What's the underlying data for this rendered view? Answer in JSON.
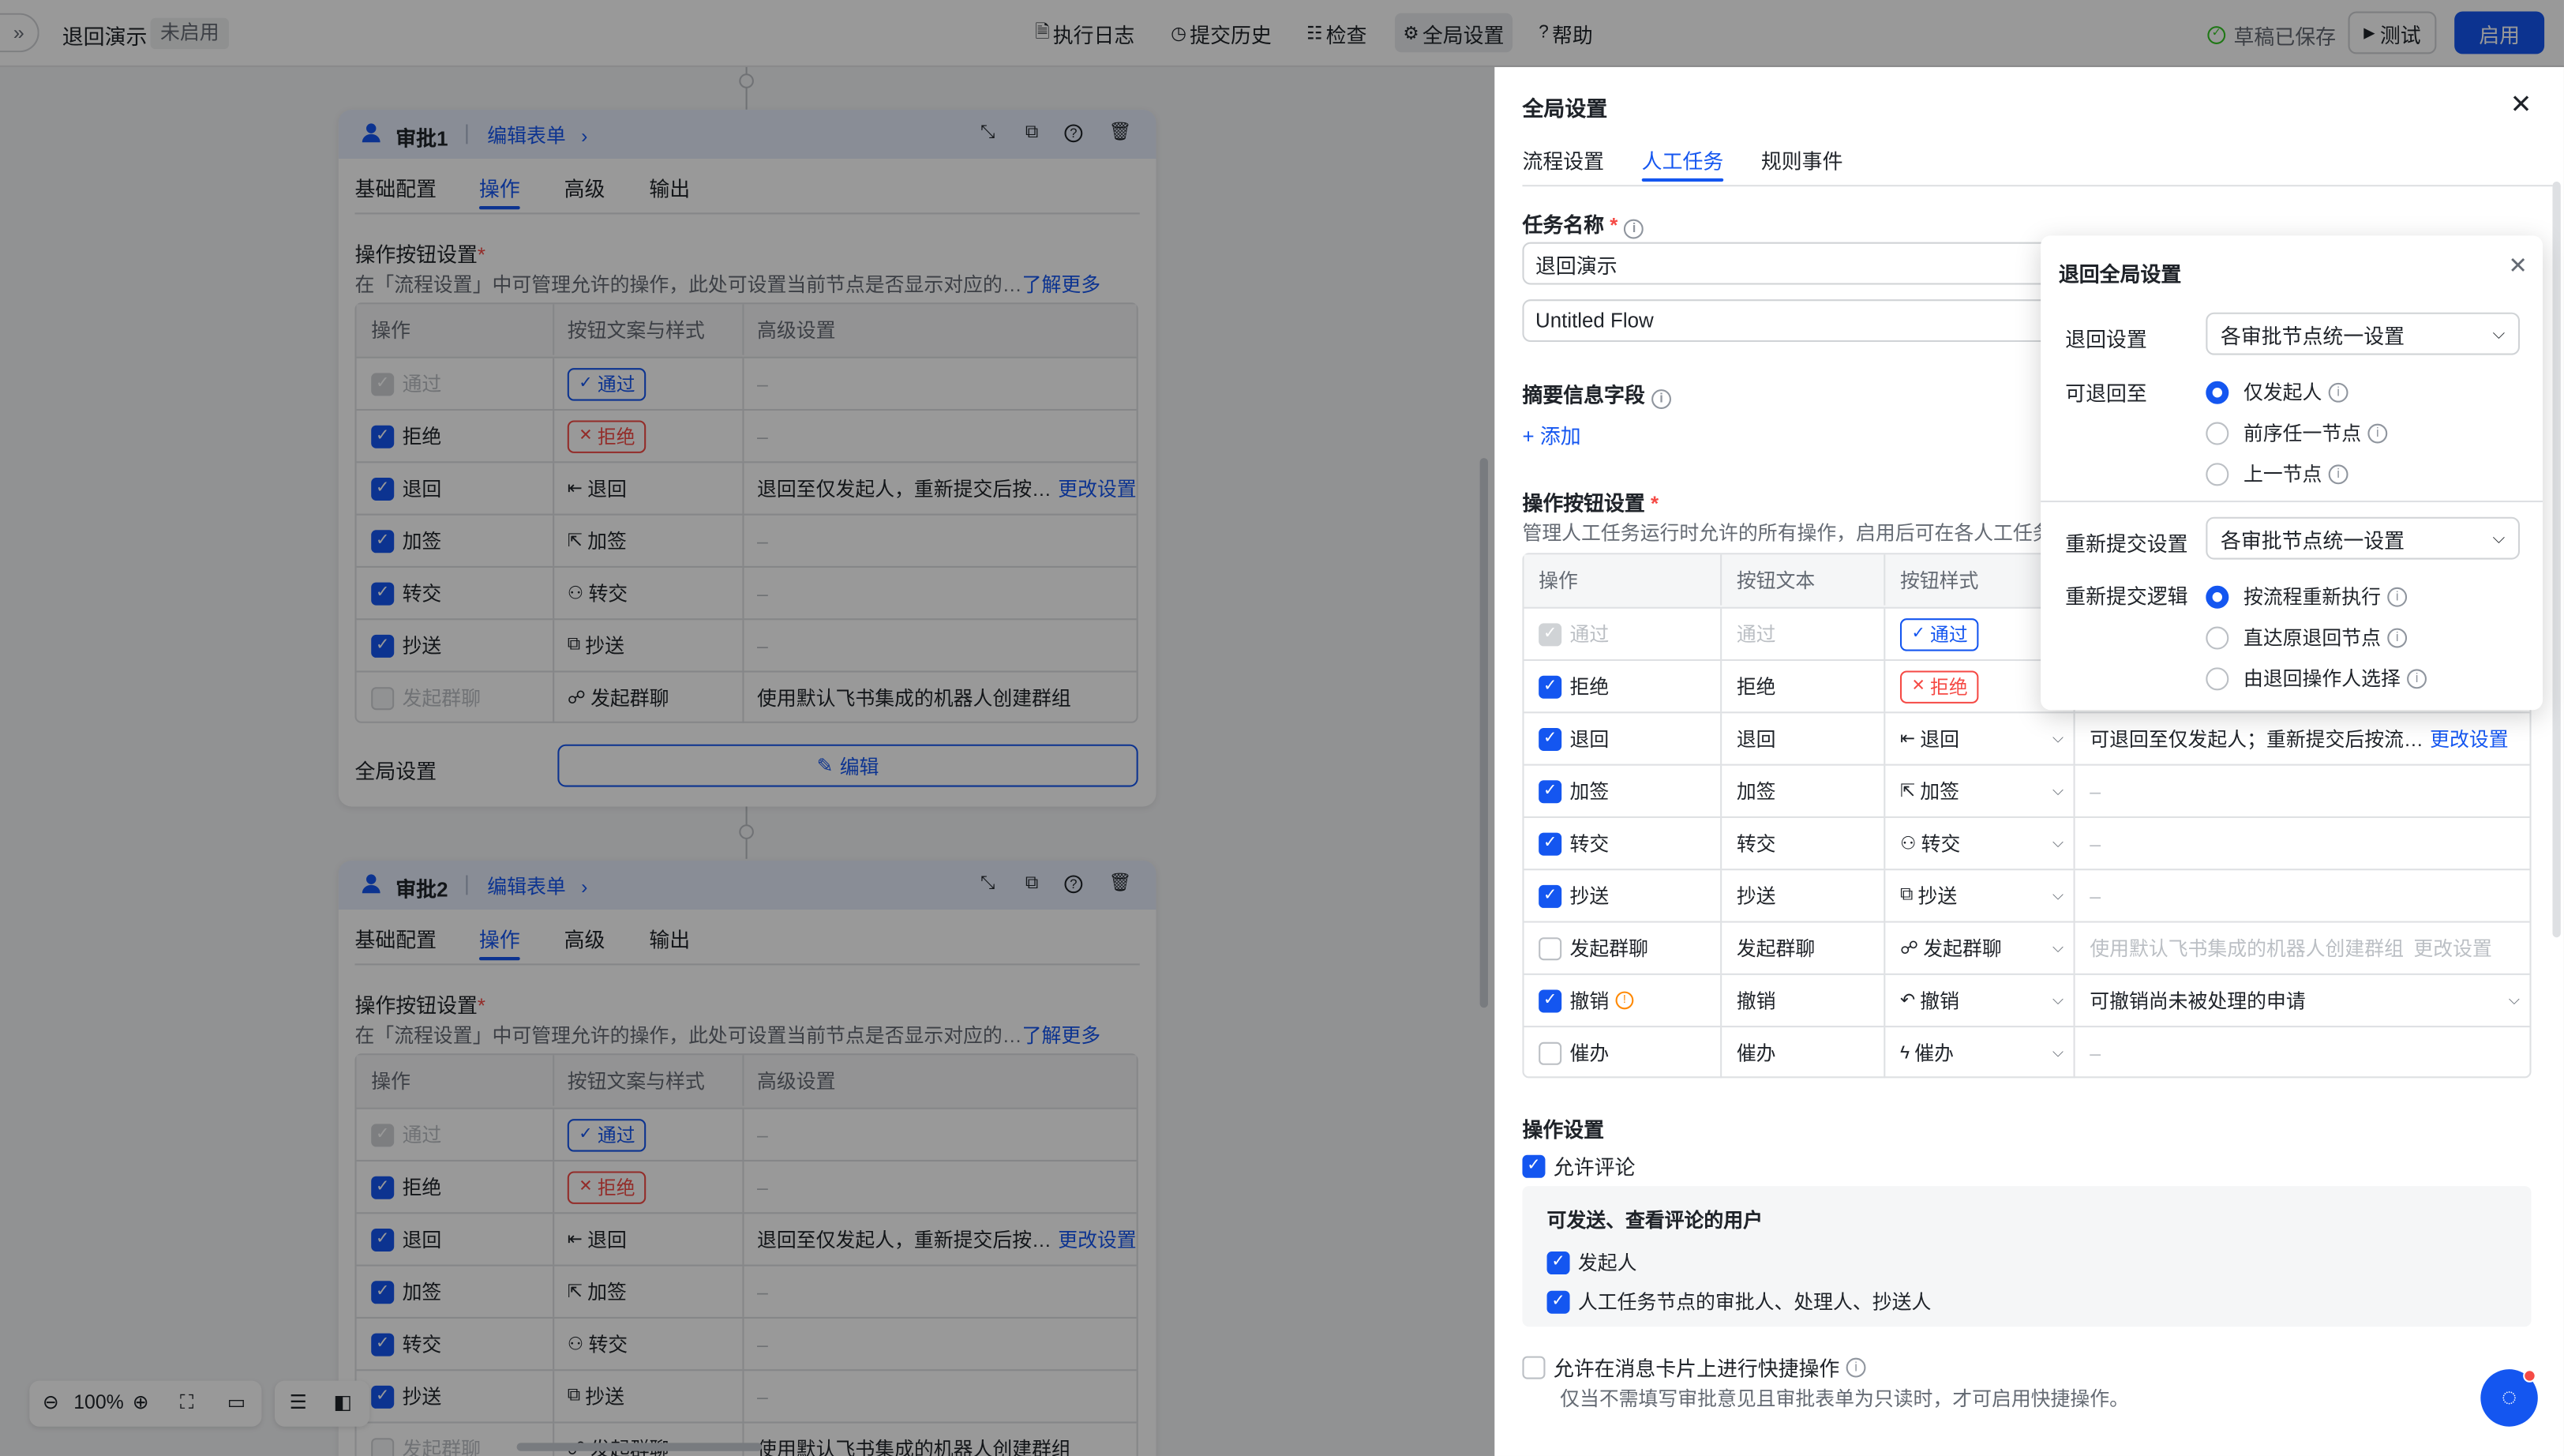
{
  "topbar": {
    "title": "退回演示",
    "status": "未启用",
    "nav": [
      {
        "icon": "log-icon",
        "glyph": "🗎",
        "label": "执行日志"
      },
      {
        "icon": "history-icon",
        "glyph": "◷",
        "label": "提交历史"
      },
      {
        "icon": "check-icon",
        "glyph": "☷",
        "label": "检查"
      },
      {
        "icon": "gear-icon",
        "glyph": "⚙",
        "label": "全局设置"
      },
      {
        "icon": "help-icon",
        "glyph": "?",
        "label": "帮助"
      }
    ],
    "saved": "草稿已保存",
    "test": "测试",
    "enable": "启用"
  },
  "canvas": {
    "nodes": [
      {
        "title": "审批1",
        "edit_form": "编辑表单",
        "tabs": [
          "基础配置",
          "操作",
          "高级",
          "输出"
        ],
        "section": "操作按钮设置",
        "desc": "在「流程设置」中可管理允许的操作，此处可设置当前节点是否显示对应的…",
        "more": "了解更多",
        "headers": [
          "操作",
          "按钮文案与样式",
          "高级设置"
        ],
        "rows": [
          {
            "op": "通过",
            "state": "checked-disabled",
            "btn": "通过",
            "style": "blue-pill",
            "glyph": "✓",
            "adv": "–"
          },
          {
            "op": "拒绝",
            "state": "checked",
            "btn": "拒绝",
            "style": "red-pill",
            "glyph": "✕",
            "adv": "–"
          },
          {
            "op": "退回",
            "state": "checked",
            "btn": "退回",
            "style": "icon",
            "glyph": "⇤",
            "adv": "退回至仅发起人，重新提交后按…",
            "adv_link": "更改设置"
          },
          {
            "op": "加签",
            "state": "checked",
            "btn": "加签",
            "style": "icon",
            "glyph": "⇱",
            "adv": "–"
          },
          {
            "op": "转交",
            "state": "checked",
            "btn": "转交",
            "style": "icon",
            "glyph": "⚇",
            "adv": "–"
          },
          {
            "op": "抄送",
            "state": "checked",
            "btn": "抄送",
            "style": "icon",
            "glyph": "⧉",
            "adv": "–"
          },
          {
            "op": "发起群聊",
            "state": "unchecked-disabled",
            "btn": "发起群聊",
            "style": "icon",
            "glyph": "☍",
            "adv": "使用默认飞书集成的机器人创建群组"
          }
        ],
        "global_label": "全局设置",
        "global_btn": "编辑"
      },
      {
        "title": "审批2",
        "edit_form": "编辑表单",
        "tabs": [
          "基础配置",
          "操作",
          "高级",
          "输出"
        ],
        "section": "操作按钮设置",
        "desc": "在「流程设置」中可管理允许的操作，此处可设置当前节点是否显示对应的…",
        "more": "了解更多",
        "headers": [
          "操作",
          "按钮文案与样式",
          "高级设置"
        ],
        "rows": [
          {
            "op": "通过",
            "state": "checked-disabled",
            "btn": "通过",
            "style": "blue-pill",
            "glyph": "✓",
            "adv": "–"
          },
          {
            "op": "拒绝",
            "state": "checked",
            "btn": "拒绝",
            "style": "red-pill",
            "glyph": "✕",
            "adv": "–"
          },
          {
            "op": "退回",
            "state": "checked",
            "btn": "退回",
            "style": "icon",
            "glyph": "⇤",
            "adv": "退回至仅发起人，重新提交后按…",
            "adv_link": "更改设置"
          },
          {
            "op": "加签",
            "state": "checked",
            "btn": "加签",
            "style": "icon",
            "glyph": "⇱",
            "adv": "–"
          },
          {
            "op": "转交",
            "state": "checked",
            "btn": "转交",
            "style": "icon",
            "glyph": "⚇",
            "adv": "–"
          },
          {
            "op": "抄送",
            "state": "checked",
            "btn": "抄送",
            "style": "icon",
            "glyph": "⧉",
            "adv": "–"
          },
          {
            "op": "发起群聊",
            "state": "unchecked-disabled",
            "btn": "发起群聊",
            "style": "icon",
            "glyph": "☍",
            "adv": "使用默认飞书集成的机器人创建群组"
          }
        ]
      }
    ],
    "zoom": "100%"
  },
  "panel": {
    "title": "全局设置",
    "tabs": [
      "流程设置",
      "人工任务",
      "规则事件"
    ],
    "active_tab": 1,
    "task_name_label": "任务名称",
    "task_name_value": "退回演示",
    "flow_name_value": "Untitled Flow",
    "summary_label": "摘要信息字段",
    "add": "添加",
    "ops_label": "操作按钮设置",
    "ops_desc": "管理人工任务运行时允许的所有操作，启用后可在各人工任务",
    "headers": [
      "操作",
      "按钮文本",
      "按钮样式"
    ],
    "rows": [
      {
        "op": "通过",
        "state": "checked-disabled",
        "text": "通过",
        "style": "blue-pill",
        "glyph": "✓",
        "adv": ""
      },
      {
        "op": "拒绝",
        "state": "checked",
        "text": "拒绝",
        "style": "red-pill",
        "glyph": "✕",
        "adv": ""
      },
      {
        "op": "退回",
        "state": "checked",
        "text": "退回",
        "style": "icon",
        "glyph": "⇤",
        "adv": "可退回至仅发起人；重新提交后按流…",
        "adv_link": "更改设置"
      },
      {
        "op": "加签",
        "state": "checked",
        "text": "加签",
        "style": "icon",
        "glyph": "⇱",
        "adv": "–"
      },
      {
        "op": "转交",
        "state": "checked",
        "text": "转交",
        "style": "icon",
        "glyph": "⚇",
        "adv": "–"
      },
      {
        "op": "抄送",
        "state": "checked",
        "text": "抄送",
        "style": "icon",
        "glyph": "⧉",
        "adv": "–"
      },
      {
        "op": "发起群聊",
        "state": "unchecked",
        "text": "发起群聊",
        "style": "icon",
        "glyph": "☍",
        "adv": "使用默认飞书集成的机器人创建群组",
        "adv_link": "更改设置"
      },
      {
        "op": "撤销",
        "state": "checked",
        "text": "撤销",
        "style": "icon",
        "glyph": "↶",
        "adv": "可撤销尚未被处理的申请",
        "warn": "!"
      },
      {
        "op": "催办",
        "state": "unchecked",
        "text": "催办",
        "style": "icon",
        "glyph": "ϟ",
        "adv": "–"
      }
    ],
    "op_settings_label": "操作设置",
    "allow_comment": "允许评论",
    "comment_users_label": "可发送、查看评论的用户",
    "comment_users": [
      "发起人",
      "人工任务节点的审批人、处理人、抄送人"
    ],
    "quick_action": "允许在消息卡片上进行快捷操作",
    "quick_action_hint": "仅当不需填写审批意见且审批表单为只读时，才可启用快捷操作。"
  },
  "popup": {
    "title": "退回全局设置",
    "return_setting_label": "退回设置",
    "return_setting_value": "各审批节点统一设置",
    "return_to_label": "可退回至",
    "return_to_options": [
      "仅发起人",
      "前序任一节点",
      "上一节点"
    ],
    "return_to_selected": 0,
    "resubmit_setting_label": "重新提交设置",
    "resubmit_setting_value": "各审批节点统一设置",
    "resubmit_logic_label": "重新提交逻辑",
    "resubmit_logic_options": [
      "按流程重新执行",
      "直达原退回节点",
      "由退回操作人选择"
    ],
    "resubmit_logic_selected": 0
  },
  "colors": {
    "primary": "#1456f0",
    "danger": "#f54a45",
    "success": "#34c724",
    "warning": "#ff8800"
  }
}
